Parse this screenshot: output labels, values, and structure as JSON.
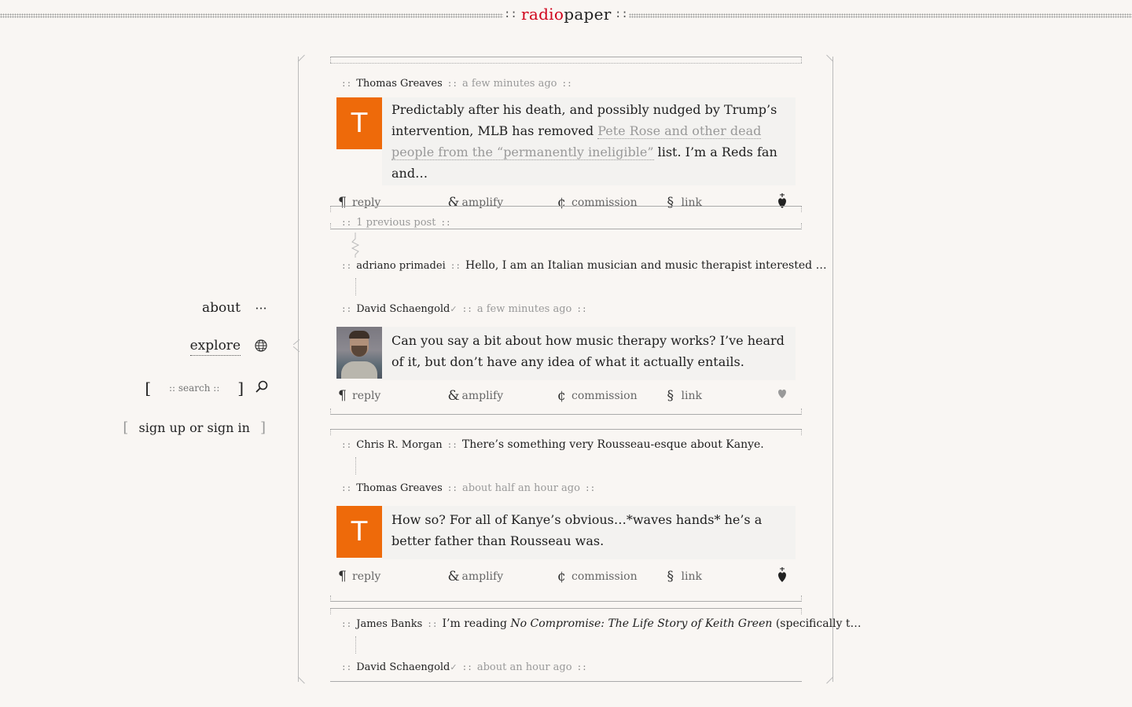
{
  "header": {
    "brand_red": "radio",
    "brand_dark": "paper",
    "separator": "::"
  },
  "nav": {
    "about_label": "about",
    "explore_label": "explore",
    "search_placeholder": ":: search ::",
    "search_bracket_left": "[",
    "search_bracket_right": "]",
    "signup_label": "sign up or sign in",
    "signup_bracket_left": "[",
    "signup_bracket_right": "]",
    "icons": {
      "about": "ellipsis-icon",
      "explore": "globe-icon",
      "search": "magnifier-icon"
    }
  },
  "actions": {
    "reply": "reply",
    "amplify": "amplify",
    "commission": "commission",
    "link": "link"
  },
  "feed": {
    "post1": {
      "author": "Thomas Greaves",
      "time": "a few minutes ago",
      "avatar_letter": "T",
      "text_before": "Predictably after his death, and possibly nudged by Trump’s intervention, MLB has removed ",
      "link_text": "Pete Rose and other dead people from the “permanently ineligible”",
      "text_after": " list. I’m a Reds fan and…"
    },
    "previous": {
      "label": "1 previous post"
    },
    "summary1": {
      "author": "adriano primadei",
      "text": "Hello, I am an Italian musician and music therapist interested …"
    },
    "post2": {
      "author": "David Schaengold",
      "verified": "✓",
      "time": "a few minutes ago",
      "text": "Can you say a bit about how music therapy works? I’ve heard of it, but don’t have any idea of what it actually entails."
    },
    "summary2": {
      "author": "Chris R. Morgan",
      "text": "There’s something very Rousseau-esque about Kanye."
    },
    "post3": {
      "author": "Thomas Greaves",
      "time": "about half an hour ago",
      "avatar_letter": "T",
      "text": "How so? For all of Kanye’s obvious…*waves hands* he’s a better father than Rousseau was."
    },
    "summary3": {
      "author": "James Banks",
      "text_before": "I’m reading ",
      "text_italic": "No Compromise: The Life Story of Keith Green",
      "text_after": " (specifically t…"
    },
    "post4": {
      "author": "David Schaengold",
      "verified": "✓",
      "time": "about an hour ago"
    }
  },
  "colors": {
    "brand_red": "#d0021b",
    "avatar_orange": "#ee6a0a",
    "background": "#f9f6f3"
  }
}
